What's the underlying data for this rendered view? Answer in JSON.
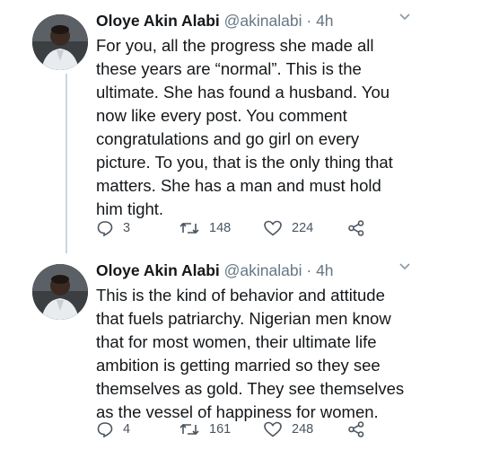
{
  "tweets": [
    {
      "name": "Oloye Akin Alabi",
      "handle": "@akinalabi",
      "separator": "·",
      "time": "4h",
      "lines": [
        "For you, all the progress she made all",
        "these years are “normal”. This is the",
        "ultimate. She has found a husband. You",
        "now like every post. You comment",
        "congratulations and go girl on every",
        "picture. To you, that is the only thing that",
        "matters. She has a man and must hold",
        "him tight."
      ],
      "replies": "3",
      "retweets": "148",
      "likes": "224"
    },
    {
      "name": "Oloye Akin Alabi",
      "handle": "@akinalabi",
      "separator": "·",
      "time": "4h",
      "lines": [
        "This is the kind of behavior and attitude",
        "that fuels patriarchy. Nigerian men know",
        "that for most women, their ultimate life",
        "ambition is getting married so they see",
        "themselves as gold. They see themselves",
        "as the vessel of happiness for women."
      ],
      "replies": "4",
      "retweets": "161",
      "likes": "248"
    }
  ],
  "icons": {
    "reply": "reply-icon",
    "retweet": "retweet-icon",
    "like": "heart-icon",
    "share": "share-icon",
    "menu": "chevron-down-icon"
  },
  "colors": {
    "text": "#14171a",
    "secondary": "#657786",
    "thread_line": "#cdd6dd"
  }
}
